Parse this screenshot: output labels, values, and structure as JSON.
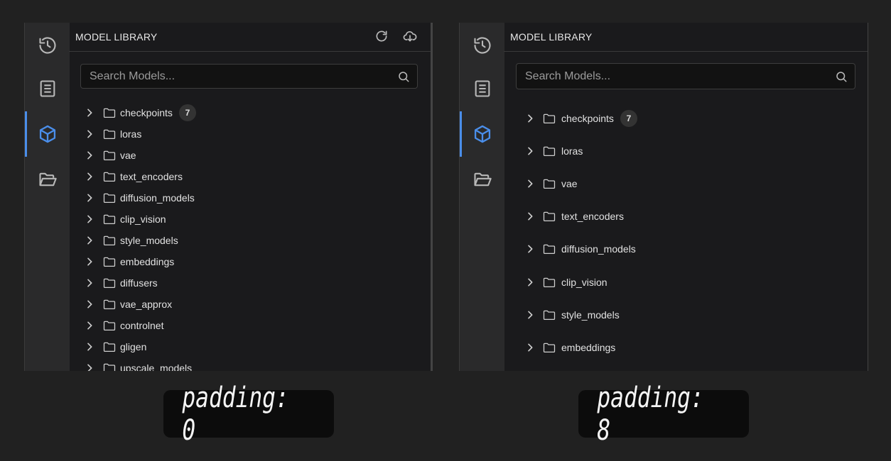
{
  "panels": [
    {
      "title": "MODEL LIBRARY",
      "search_placeholder": "Search Models...",
      "caption": "padding: 0",
      "items": [
        {
          "label": "checkpoints",
          "badge": "7"
        },
        {
          "label": "loras"
        },
        {
          "label": "vae"
        },
        {
          "label": "text_encoders"
        },
        {
          "label": "diffusion_models"
        },
        {
          "label": "clip_vision"
        },
        {
          "label": "style_models"
        },
        {
          "label": "embeddings"
        },
        {
          "label": "diffusers"
        },
        {
          "label": "vae_approx"
        },
        {
          "label": "controlnet"
        },
        {
          "label": "gligen"
        },
        {
          "label": "upscale_models"
        }
      ]
    },
    {
      "title": "MODEL LIBRARY",
      "search_placeholder": "Search Models...",
      "caption": "padding: 8",
      "items": [
        {
          "label": "checkpoints",
          "badge": "7"
        },
        {
          "label": "loras"
        },
        {
          "label": "vae"
        },
        {
          "label": "text_encoders"
        },
        {
          "label": "diffusion_models"
        },
        {
          "label": "clip_vision"
        },
        {
          "label": "style_models"
        },
        {
          "label": "embeddings"
        }
      ]
    }
  ],
  "sidebar_icons": [
    "history-icon",
    "book-icon",
    "cube-icon",
    "folder-open-icon"
  ],
  "colors": {
    "accent": "#4a8eea",
    "panel": "#1a1a1c",
    "sidebar": "#2a2a2b",
    "background": "#212121"
  }
}
